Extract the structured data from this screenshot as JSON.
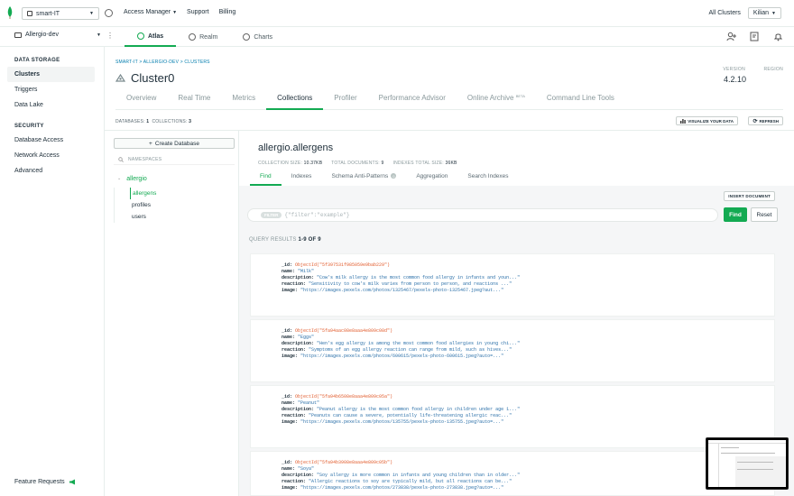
{
  "topbar": {
    "org": "smart-IT",
    "nav": [
      "Access Manager",
      "Support",
      "Billing"
    ],
    "all_clusters": "All Clusters",
    "user": "Kilian"
  },
  "projectbar": {
    "project": "Allergio-dev",
    "tabs": [
      "Atlas",
      "Realm",
      "Charts"
    ],
    "active_tab": "Atlas"
  },
  "sidebar": {
    "data_storage_heading": "DATA STORAGE",
    "data_storage": [
      "Clusters",
      "Triggers",
      "Data Lake"
    ],
    "security_heading": "SECURITY",
    "security": [
      "Database Access",
      "Network Access",
      "Advanced"
    ],
    "feature_requests": "Feature Requests"
  },
  "cluster": {
    "breadcrumb": "SMART-IT > ALLERGIO-DEV > CLUSTERS",
    "name": "Cluster0",
    "version_label": "VERSION",
    "version": "4.2.10",
    "region_label": "REGION",
    "tabs": [
      "Overview",
      "Real Time",
      "Metrics",
      "Collections",
      "Profiler",
      "Performance Advisor",
      "Online Archive",
      "Command Line Tools"
    ],
    "beta": "BETA",
    "active_tab": "Collections"
  },
  "collections": {
    "databases_label": "DATABASES:",
    "databases": "1",
    "collections_label": "COLLECTIONS:",
    "collections": "3",
    "visualize": "VISUALIZE YOUR DATA",
    "refresh": "REFRESH",
    "create_db": "Create Database",
    "namespaces_placeholder": "NAMESPACES",
    "db_name": "allergio",
    "coll_list": [
      "allergens",
      "profiles",
      "users"
    ]
  },
  "detail": {
    "title": "allergio.allergens",
    "coll_size_label": "COLLECTION SIZE:",
    "coll_size": "10.37KB",
    "total_docs_label": "TOTAL DOCUMENTS:",
    "total_docs": "9",
    "index_size_label": "INDEXES TOTAL SIZE:",
    "index_size": "36KB",
    "tabs": [
      "Find",
      "Indexes",
      "Schema Anti-Patterns",
      "Aggregation",
      "Search Indexes"
    ],
    "anti_pattern_count": "0",
    "insert_document": "INSERT DOCUMENT",
    "filter_label": "FILTER",
    "filter_placeholder": "{\"filter\":\"example\"}",
    "find": "Find",
    "reset": "Reset",
    "results_label": "QUERY RESULTS",
    "results_range": "1-9 OF 9"
  },
  "documents": [
    {
      "id": "ObjectId(\"5f397531f985059e9bab229\")",
      "name": "\"Milk\"",
      "description": "\"Cow's milk allergy is the most common food allergy in infants and youn...\"",
      "reaction": "\"Sensitivity to cow's milk varies from person to person, and reactions ...\"",
      "image": "\"https://images.pexels.com/photos/1325467/pexels-photo-1325467.jpeg?aut...\""
    },
    {
      "id": "ObjectId(\"5fa94aac08e8aaa4e809c08d\")",
      "name": "\"Eggs\"",
      "description": "\"Hen's egg allergy is among the most common food allergies in young chi...\"",
      "reaction": "\"Symptoms of an egg allergy reaction can range from mild, such as hives...\"",
      "image": "\"https://images.pexels.com/photos/600615/pexels-photo-600615.jpeg?auto=...\""
    },
    {
      "id": "ObjectId(\"5fa94b6508e8aaa4e809c05a\")",
      "name": "\"Peanut\"",
      "description": "\"Peanut allergy is the most common food allergy in children under age 1...\"",
      "reaction": "\"Peanuts can cause a severe, potentially life-threatening allergic reac...\"",
      "image": "\"https://images.pexels.com/photos/135755/pexels-photo-135755.jpeg?auto=...\""
    },
    {
      "id": "ObjectId(\"5fa94b3908e8aaa4e809c05b\")",
      "name": "\"Soya\"",
      "description": "\"Soy allergy is more common in infants and young children than in older...\"",
      "reaction": "\"Allergic reactions to soy are typically mild, but all reactions can be...\"",
      "image": "\"https://images.pexels.com/photos/273838/pexels-photo-273838.jpeg?auto=...\""
    }
  ],
  "doc_keys": {
    "id": "_id:",
    "name": "name:",
    "description": "description:",
    "reaction": "reaction:",
    "image": "image:"
  },
  "colors": {
    "accent": "#13aa52",
    "objectid": "#e25d2e",
    "string": "#2a6fa8"
  }
}
